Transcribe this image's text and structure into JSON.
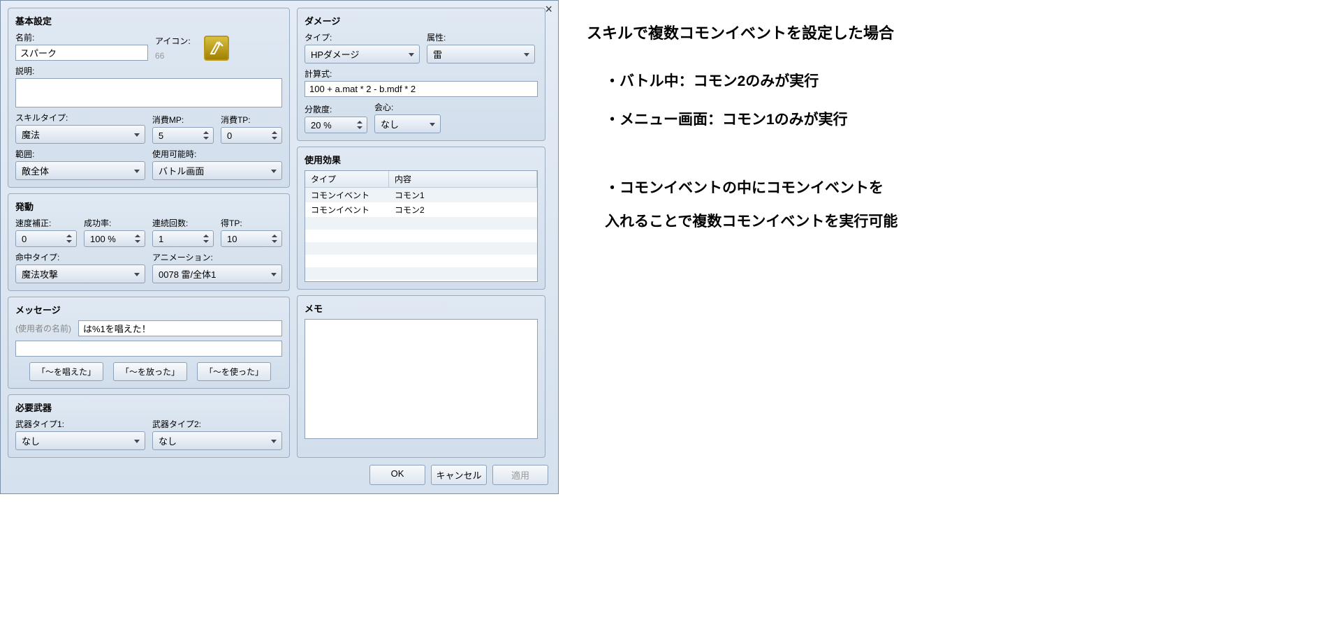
{
  "dialog": {
    "close": "×",
    "basic": {
      "title": "基本設定",
      "name_label": "名前:",
      "name_value": "スパーク",
      "icon_label": "アイコン:",
      "icon_number": "66",
      "desc_label": "説明:",
      "desc_value": "",
      "skilltype_label": "スキルタイプ:",
      "skilltype_value": "魔法",
      "mp_label": "消費MP:",
      "mp_value": "5",
      "tp_label": "消費TP:",
      "tp_value": "0",
      "scope_label": "範囲:",
      "scope_value": "敵全体",
      "occasion_label": "使用可能時:",
      "occasion_value": "バトル画面"
    },
    "invoke": {
      "title": "発動",
      "speed_label": "速度補正:",
      "speed_value": "0",
      "success_label": "成功率:",
      "success_value": "100 %",
      "repeat_label": "連続回数:",
      "repeat_value": "1",
      "tpgain_label": "得TP:",
      "tpgain_value": "10",
      "hittype_label": "命中タイプ:",
      "hittype_value": "魔法攻撃",
      "anim_label": "アニメーション:",
      "anim_value": "0078 雷/全体1"
    },
    "message": {
      "title": "メッセージ",
      "user_placeholder": "(使用者の名前)",
      "line1": "は%1を唱えた！",
      "line2": "",
      "btn1": "「〜を唱えた」",
      "btn2": "「〜を放った」",
      "btn3": "「〜を使った」"
    },
    "weapon": {
      "title": "必要武器",
      "w1_label": "武器タイプ1:",
      "w1_value": "なし",
      "w2_label": "武器タイプ2:",
      "w2_value": "なし"
    },
    "damage": {
      "title": "ダメージ",
      "type_label": "タイプ:",
      "type_value": "HPダメージ",
      "element_label": "属性:",
      "element_value": "雷",
      "formula_label": "計算式:",
      "formula_value": "100 + a.mat * 2 - b.mdf * 2",
      "variance_label": "分散度:",
      "variance_value": "20 %",
      "critical_label": "会心:",
      "critical_value": "なし"
    },
    "effects": {
      "title": "使用効果",
      "col1": "タイプ",
      "col2": "内容",
      "rows": [
        {
          "type": "コモンイベント",
          "content": "コモン1"
        },
        {
          "type": "コモンイベント",
          "content": "コモン2"
        }
      ]
    },
    "memo": {
      "title": "メモ",
      "value": ""
    },
    "footer": {
      "ok": "OK",
      "cancel": "キャンセル",
      "apply": "適用"
    }
  },
  "notes": {
    "heading": "スキルで複数コモンイベントを設定した場合",
    "b1": "・バトル中：コモン2のみが実行",
    "b2": "・メニュー画面：コモン1のみが実行",
    "b3": "・コモンイベントの中にコモンイベントを",
    "b3sub": "入れることで複数コモンイベントを実行可能"
  }
}
